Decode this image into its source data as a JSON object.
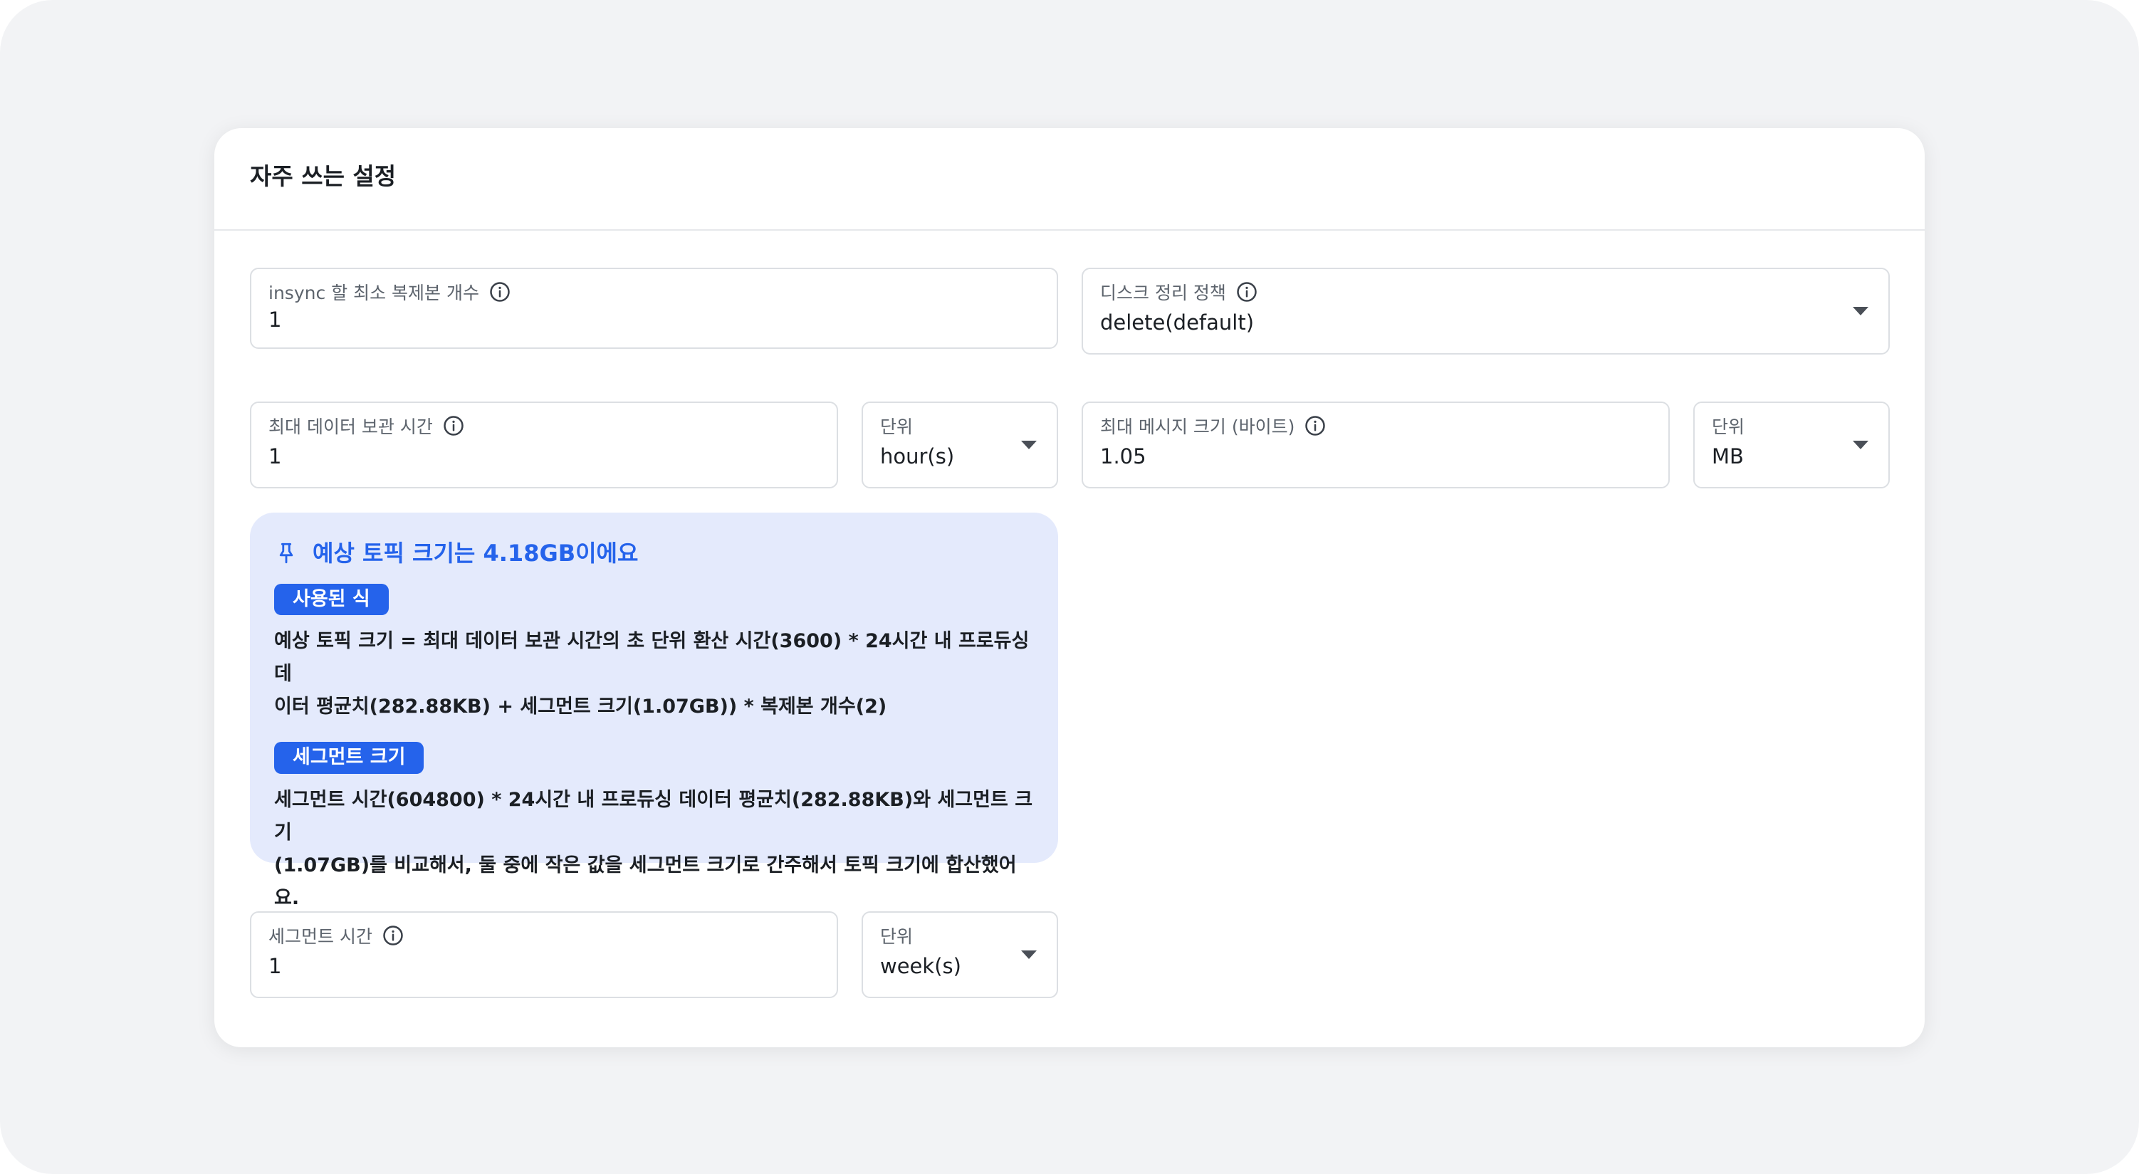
{
  "card": {
    "title": "자주 쓰는 설정"
  },
  "fields": {
    "min_insync": {
      "label": "insync 할 최소 복제본 개수",
      "value": "1"
    },
    "cleanup_policy": {
      "label": "디스크 정리 정책",
      "value": "delete(default)"
    },
    "retention_time": {
      "label": "최대 데이터 보관 시간",
      "value": "1"
    },
    "retention_unit": {
      "label": "단위",
      "value": "hour(s)"
    },
    "max_message_size": {
      "label": "최대 메시지 크기 (바이트)",
      "value": "1.05"
    },
    "message_size_unit": {
      "label": "단위",
      "value": "MB"
    },
    "segment_time": {
      "label": "세그먼트 시간",
      "value": "1"
    },
    "segment_unit": {
      "label": "단위",
      "value": "week(s)"
    }
  },
  "callout": {
    "title": "예상 토픽 크기는 4.18GB이에요",
    "formula_badge": "사용된 식",
    "formula_line1": "예상 토픽 크기 = 최대 데이터 보관 시간의 초 단위 환산 시간(3600) * 24시간 내 프로듀싱 데",
    "formula_line2": "이터 평균치(282.88KB) + 세그먼트 크기(1.07GB)) * 복제본 개수(2)",
    "segment_badge": "세그먼트 크기",
    "segment_line1": "세그먼트 시간(604800) * 24시간 내 프로듀싱 데이터 평균치(282.88KB)와 세그먼트 크기",
    "segment_line2": "(1.07GB)를 비교해서, 둘 중에 작은 값을 세그먼트 크기로 간주해서 토픽 크기에 합산했어요."
  },
  "icons": {
    "info": "info-icon",
    "dropdown": "chevron-down-icon",
    "callout": "pin-icon"
  },
  "colors": {
    "accent": "#2563eb",
    "callout_bg": "#e4eafc",
    "page_bg": "#f2f3f5"
  }
}
